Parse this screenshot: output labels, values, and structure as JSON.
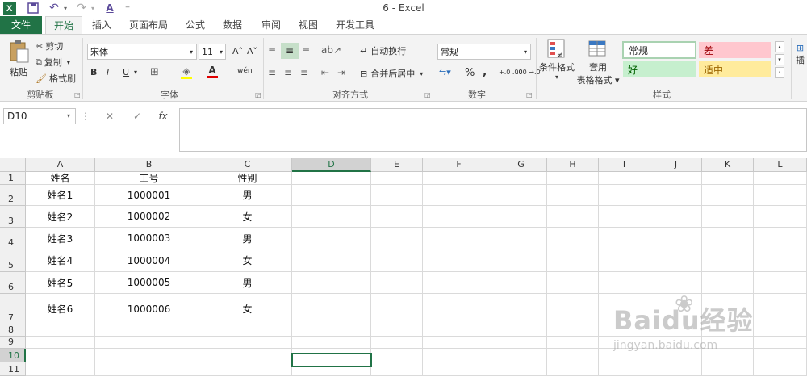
{
  "window": {
    "title": "6 - Excel"
  },
  "quick_access": {
    "undo": "↶",
    "redo": "↷",
    "font_color_label": "A",
    "customize": "⁼"
  },
  "tabs": [
    "文件",
    "开始",
    "插入",
    "页面布局",
    "公式",
    "数据",
    "审阅",
    "视图",
    "开发工具"
  ],
  "ribbon": {
    "clipboard": {
      "paste": "粘贴",
      "cut": "剪切",
      "copy": "复制",
      "format_painter": "格式刷",
      "group": "剪贴板"
    },
    "font": {
      "font_name": "宋体",
      "font_size": "11",
      "grow": "A˄",
      "shrink": "A˅",
      "bold": "B",
      "italic": "I",
      "underline": "U",
      "phonetic": "wén",
      "group": "字体"
    },
    "alignment": {
      "wrap_text": "自动换行",
      "merge_center": "合并后居中",
      "group": "对齐方式"
    },
    "number": {
      "format": "常规",
      "percent": "%",
      "comma": ",",
      "inc_decimal": "+.0 .00",
      "dec_decimal": ".00 →.0",
      "group": "数字"
    },
    "styles": {
      "conditional": "条件格式",
      "table_format_1": "套用",
      "table_format_2": "表格格式",
      "normal": "常规",
      "bad": "差",
      "good": "好",
      "neutral": "适中",
      "group": "样式"
    },
    "insert_partial": "插"
  },
  "formula_bar": {
    "name_box": "D10",
    "cancel": "✕",
    "enter": "✓",
    "fx": "fx",
    "value": ""
  },
  "sheet": {
    "columns": [
      "A",
      "B",
      "C",
      "D",
      "E",
      "F",
      "G",
      "H",
      "I",
      "J",
      "K",
      "L"
    ],
    "selected_column": "D",
    "selected_row": "10",
    "rows": [
      {
        "num": "1",
        "cells": [
          "姓名",
          "工号",
          "性别"
        ]
      },
      {
        "num": "2",
        "cells": [
          "姓名1",
          "1000001",
          "男"
        ]
      },
      {
        "num": "3",
        "cells": [
          "姓名2",
          "1000002",
          "女"
        ]
      },
      {
        "num": "4",
        "cells": [
          "姓名3",
          "1000003",
          "男"
        ]
      },
      {
        "num": "5",
        "cells": [
          "姓名4",
          "1000004",
          "女"
        ]
      },
      {
        "num": "6",
        "cells": [
          "姓名5",
          "1000005",
          "男"
        ]
      },
      {
        "num": "7",
        "cells": [
          "姓名6",
          "1000006",
          "女"
        ]
      },
      {
        "num": "8",
        "cells": [
          "",
          "",
          ""
        ]
      },
      {
        "num": "9",
        "cells": [
          "",
          "",
          ""
        ]
      },
      {
        "num": "10",
        "cells": [
          "",
          "",
          ""
        ]
      },
      {
        "num": "11",
        "cells": [
          "",
          "",
          ""
        ]
      }
    ]
  },
  "watermark": {
    "brand": "Baidu经验",
    "url": "jingyan.baidu.com"
  },
  "colors": {
    "accent": "#217346",
    "bad_bg": "#ffc7ce",
    "bad_fg": "#9c0006",
    "good_bg": "#c6efce",
    "good_fg": "#006100",
    "neutral_bg": "#ffeb9c",
    "neutral_fg": "#9c6500"
  }
}
